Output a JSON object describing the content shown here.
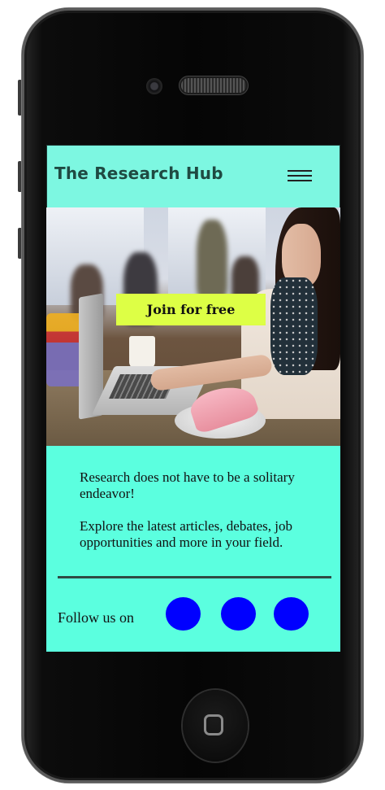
{
  "app": {
    "title": "The Research Hub",
    "menu_icon": "hamburger-menu-icon"
  },
  "hero": {
    "cta_label": "Join for free",
    "image": "photo-woman-working-on-laptop-in-cafe"
  },
  "intro": {
    "paragraph_1": "Research does not have to be a solitary endeavor!",
    "paragraph_2": "Explore the latest articles, debates, job opportunities and more in your field."
  },
  "footer": {
    "follow_label": "Follow us on",
    "social_links": [
      {
        "icon": "social-icon-1",
        "color": "#0000ff"
      },
      {
        "icon": "social-icon-2",
        "color": "#0000ff"
      },
      {
        "icon": "social-icon-3",
        "color": "#0000ff"
      }
    ]
  },
  "colors": {
    "header_bg": "#7df7e1",
    "page_bg": "#5bffdf",
    "cta_bg": "#ddff45",
    "title_text": "#1f4a42",
    "social_circle": "#0000ff"
  }
}
